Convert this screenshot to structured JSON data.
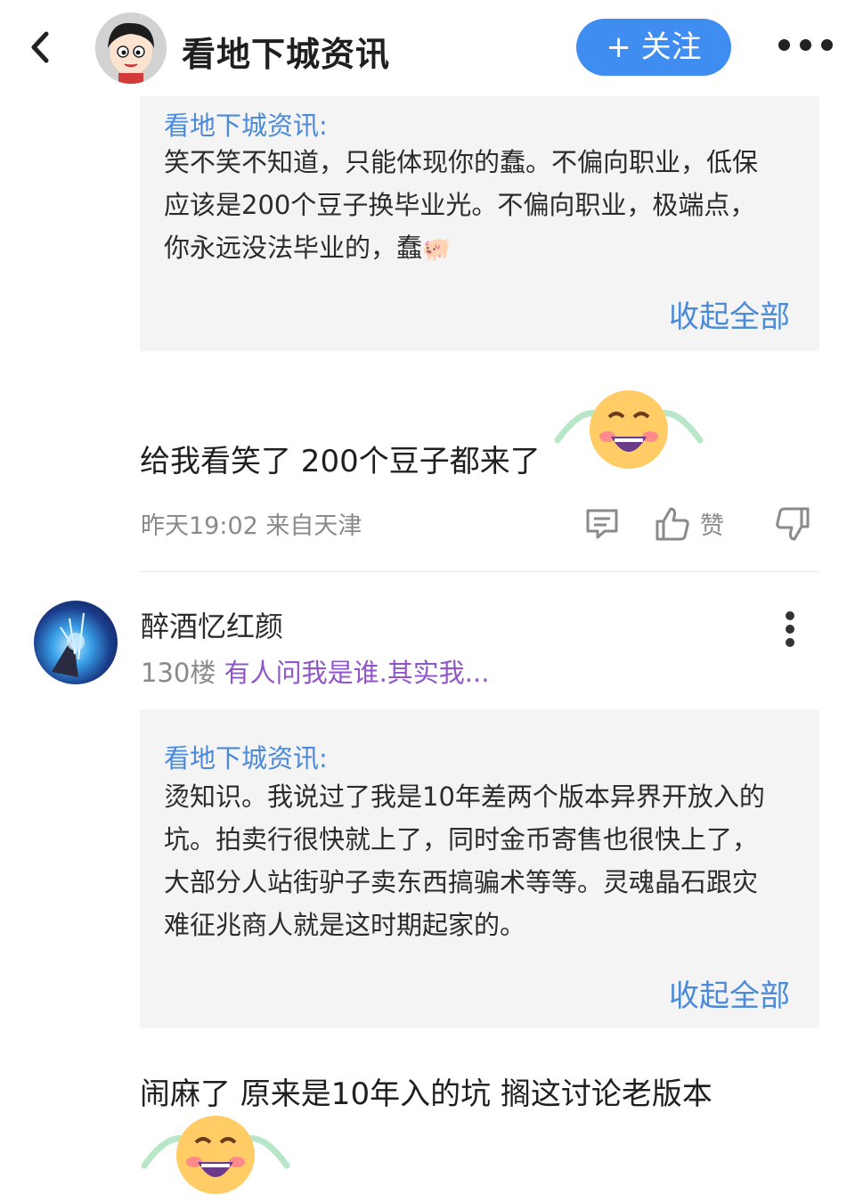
{
  "header": {
    "title": "看地下城资讯",
    "follow_label": "+ 关注",
    "icons": {
      "back": "back-icon",
      "more": "more-horizontal-icon"
    }
  },
  "thread1": {
    "quote_author": "看地下城资讯:",
    "quote_lines": [
      "笑不笑不知道，只能体现你的蠢。不偏向职业，低保",
      "应该是200个豆子换毕业光。不偏向职业，极端点，",
      "你永远没法毕业的，蠢"
    ],
    "quote_emoji": "🐖",
    "collapse_label": "收起全部",
    "reply_text": "给我看笑了 200个豆子都来了",
    "reply_emoji": "laugh-cry-emoji",
    "time_location": "昨天19:02 来自天津",
    "like_label": "赞"
  },
  "thread2": {
    "username": "醉酒忆红颜",
    "floor": "130楼",
    "signature": "有人问我是谁.其实我...",
    "quote_author": "看地下城资讯:",
    "quote_lines": [
      "烫知识。我说过了我是10年差两个版本异界开放入的",
      "坑。拍卖行很快就上了，同时金币寄售也很快上了，",
      "大部分人站街驴子卖东西搞骗术等等。灵魂晶石跟灾",
      "难征兆商人就是这时期起家的。"
    ],
    "collapse_label": "收起全部",
    "reply_text": "闹麻了 原来是10年入的坑 搁这讨论老版本",
    "reply_emoji": "laugh-cry-emoji"
  },
  "colors": {
    "accent": "#3f8df0",
    "link": "#4a8ad8",
    "signature": "#9055c8",
    "quote_bg": "#f4f4f4",
    "meta_gray": "#8a8a8a"
  }
}
